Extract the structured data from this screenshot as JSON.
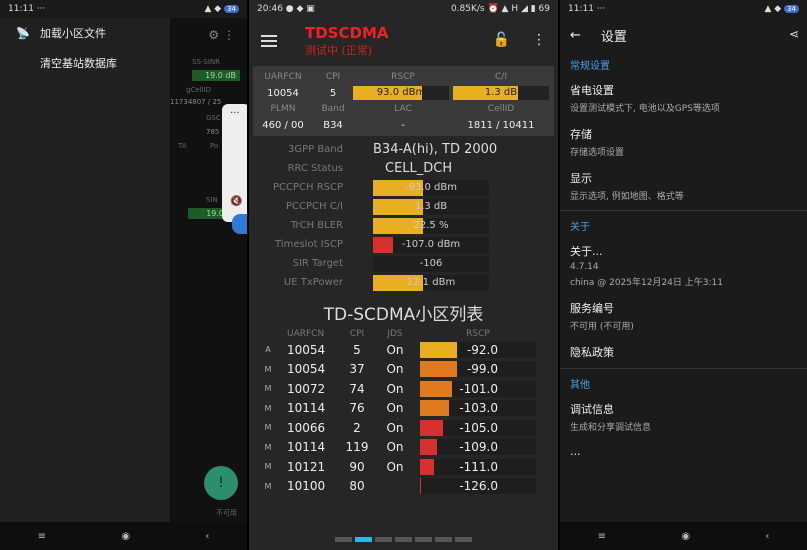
{
  "panel1": {
    "status": {
      "time": "11:11",
      "dots": "···",
      "battery": "34"
    },
    "menu": [
      {
        "label": "加载小区文件",
        "icon": "antenna-icon"
      },
      {
        "label": "清空基站数据库",
        "icon": ""
      }
    ],
    "bg": {
      "ss_sinr": "SS-SINR",
      "val1": "19.0 dB",
      "gcellid": "gCellID",
      "cellid_val": "11734807 / 25",
      "gsc": "GSC",
      "n785": "785",
      "ta": "TA",
      "po": "Po",
      "sin": "SIN",
      "val2": "19.0",
      "footer": "不可用"
    }
  },
  "panel2": {
    "status": {
      "time": "20:46",
      "speed": "0.85K/s",
      "battery": "69"
    },
    "title": "TDSCDMA",
    "subtitle": "测试中 (正常)",
    "grid": {
      "head1": [
        "UARFCN",
        "CPI",
        "RSCP",
        "C/I"
      ],
      "row1": {
        "uarfcn": "10054",
        "cpi": "5",
        "rscp": "93.0 dBm",
        "ci": "1.3 dB"
      },
      "head2": [
        "PLMN",
        "Band",
        "LAC",
        "CellID"
      ],
      "row2": {
        "plmn": "460 / 00",
        "band": "B34",
        "lac": "-",
        "cellid": "1811 / 10411"
      }
    },
    "kv": [
      {
        "k": "3GPP Band",
        "v": "B34-A(hi), TD 2000"
      },
      {
        "k": "RRC Status",
        "v": "CELL_DCH"
      }
    ],
    "metrics": [
      {
        "k": "PCCPCH RSCP",
        "v": "-93.0 dBm",
        "level": 0.43,
        "color": "#e8b020"
      },
      {
        "k": "PCCPCH C/I",
        "v": "1.3 dB",
        "level": 0.43,
        "color": "#e8b020"
      },
      {
        "k": "TrCH BLER",
        "v": "22.5 %",
        "level": 0.43,
        "color": "#e8b020"
      },
      {
        "k": "Timeslot ISCP",
        "v": "-107.0 dBm",
        "level": 0.17,
        "color": "#d83030"
      },
      {
        "k": "SIR Target",
        "v": "-106",
        "level": 0,
        "color": "#e8b020"
      },
      {
        "k": "UE TxPower",
        "v": "12.1 dBm",
        "level": 0.43,
        "color": "#e8b020"
      }
    ],
    "cell_title": "TD-SCDMA小区列表",
    "cell_head": [
      "UARFCN",
      "CPI",
      "JDS",
      "RSCP"
    ],
    "cells": [
      {
        "t": "A",
        "u": "10054",
        "p": "5",
        "j": "On",
        "r": "-92.0",
        "level": 0.32,
        "color": "#e8b020"
      },
      {
        "t": "M",
        "u": "10054",
        "p": "37",
        "j": "On",
        "r": "-99.0",
        "level": 0.32,
        "color": "#e07a20"
      },
      {
        "t": "M",
        "u": "10072",
        "p": "74",
        "j": "On",
        "r": "-101.0",
        "level": 0.28,
        "color": "#e07a20"
      },
      {
        "t": "M",
        "u": "10114",
        "p": "76",
        "j": "On",
        "r": "-103.0",
        "level": 0.25,
        "color": "#e07a20"
      },
      {
        "t": "M",
        "u": "10066",
        "p": "2",
        "j": "On",
        "r": "-105.0",
        "level": 0.2,
        "color": "#d83030"
      },
      {
        "t": "M",
        "u": "10114",
        "p": "119",
        "j": "On",
        "r": "-109.0",
        "level": 0.15,
        "color": "#d83030"
      },
      {
        "t": "M",
        "u": "10121",
        "p": "90",
        "j": "On",
        "r": "-111.0",
        "level": 0.12,
        "color": "#d83030"
      },
      {
        "t": "M",
        "u": "10100",
        "p": "80",
        "j": "",
        "r": "-126.0",
        "level": 0.01,
        "color": "#d83030"
      }
    ]
  },
  "panel3": {
    "status": {
      "time": "11:11",
      "dots": "···",
      "battery": "34"
    },
    "title": "设置",
    "cat1": "常规设置",
    "items1": [
      {
        "t": "省电设置",
        "s": "设置测试模式下, 电池以及GPS等选项"
      },
      {
        "t": "存储",
        "s": "存储选项设置"
      },
      {
        "t": "显示",
        "s": "显示选项, 例如地图、格式等"
      }
    ],
    "cat2": "关于",
    "about": {
      "t": "关于...",
      "s1": "4.7.14",
      "s2": "china @ 2025年12月24日 上午3:11"
    },
    "service": {
      "t": "服务编号",
      "s": "不可用 (不可用)"
    },
    "privacy": {
      "t": "隐私政策"
    },
    "cat3": "其他",
    "debug": {
      "t": "调试信息",
      "s": "生成和分享调试信息"
    },
    "more": {
      "t": "..."
    }
  },
  "colors": {
    "accent": "#4a9fe8",
    "title_red": "#e22222",
    "bar_yellow": "#e8b020",
    "bar_orange": "#e07a20",
    "bar_red": "#d83030",
    "pager_active": "#2ab8e6"
  }
}
